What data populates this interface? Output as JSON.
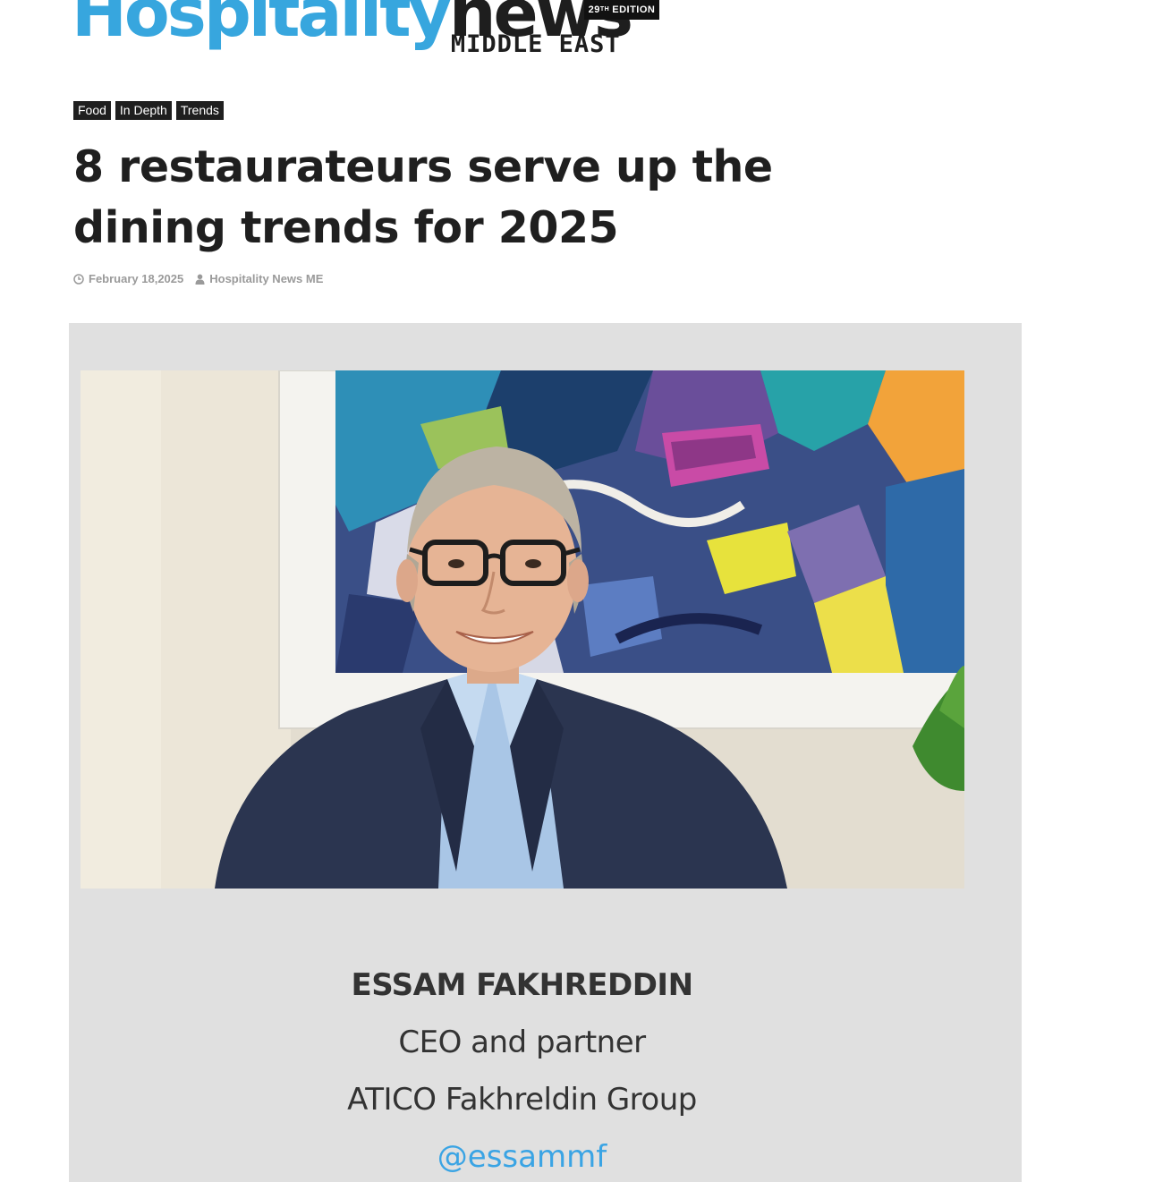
{
  "header": {
    "logo_primary": "Hospitality",
    "logo_secondary": "news",
    "logo_sub": "MIDDLE EAST",
    "edition_number": "29",
    "edition_suffix": "TH",
    "edition_label": "EDITION"
  },
  "article": {
    "tags": [
      "Food",
      "In Depth",
      "Trends"
    ],
    "title": "8 restaurateurs serve up the dining trends for 2025",
    "date": "February 18,2025",
    "author": "Hospitality News ME"
  },
  "featured": {
    "photo_alt": "Portrait of Essam Fakhreddin",
    "name": "ESSAM FAKHREDDIN",
    "role": "CEO and partner",
    "company": "ATICO Fakhreldin Group",
    "handle": "@essammf"
  },
  "colors": {
    "brand_blue": "#37a6de",
    "brand_dark": "#1e1e1e",
    "tag_bg": "#1f1f1f",
    "panel_bg": "#e0e0e0",
    "link": "#3aa4e4",
    "meta": "#9a9a9a"
  },
  "icons": {
    "date": "clock-icon",
    "author": "user-icon"
  }
}
